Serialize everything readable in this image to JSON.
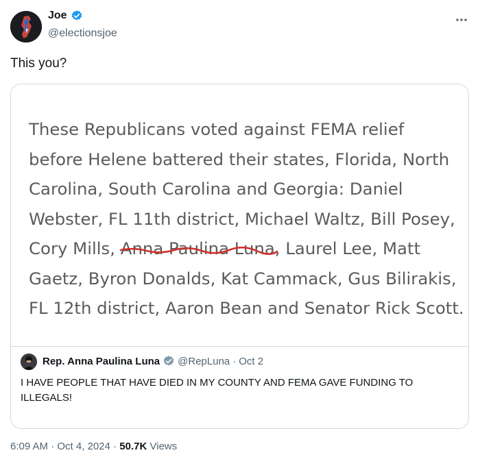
{
  "author": {
    "name": "Joe",
    "handle": "@electionsjoe",
    "verified_color": "#1d9bf0"
  },
  "tweet": {
    "text": "This you?"
  },
  "embedded_image": {
    "lines": [
      "These Republicans voted against FEMA relief",
      "before Helene battered their states, Florida, North",
      "Carolina, South Carolina and Georgia: Daniel",
      "Webster, FL 11th district, Michael Waltz, Bill Posey,",
      "Cory Mills, Anna Paulina Luna, Laurel Lee, Matt",
      "Gaetz, Byron Donalds, Kat Cammack, Gus Bilirakis,",
      "FL 12th district, Aaron Bean and Senator Rick Scott."
    ],
    "underline_color": "#d0312d"
  },
  "quoted_tweet": {
    "name": "Rep. Anna Paulina Luna",
    "handle": "@RepLuna",
    "separator": "·",
    "date": "Oct 2",
    "text": "I HAVE PEOPLE THAT HAVE DIED IN MY COUNTY AND FEMA GAVE FUNDING TO ILLEGALS!",
    "verified_color": "#829aab"
  },
  "meta": {
    "time": "6:09 AM",
    "sep1": "·",
    "date": "Oct 4, 2024",
    "sep2": "·",
    "views_count": "50.7K",
    "views_label": "Views"
  },
  "more_icon": "more-dots-icon"
}
